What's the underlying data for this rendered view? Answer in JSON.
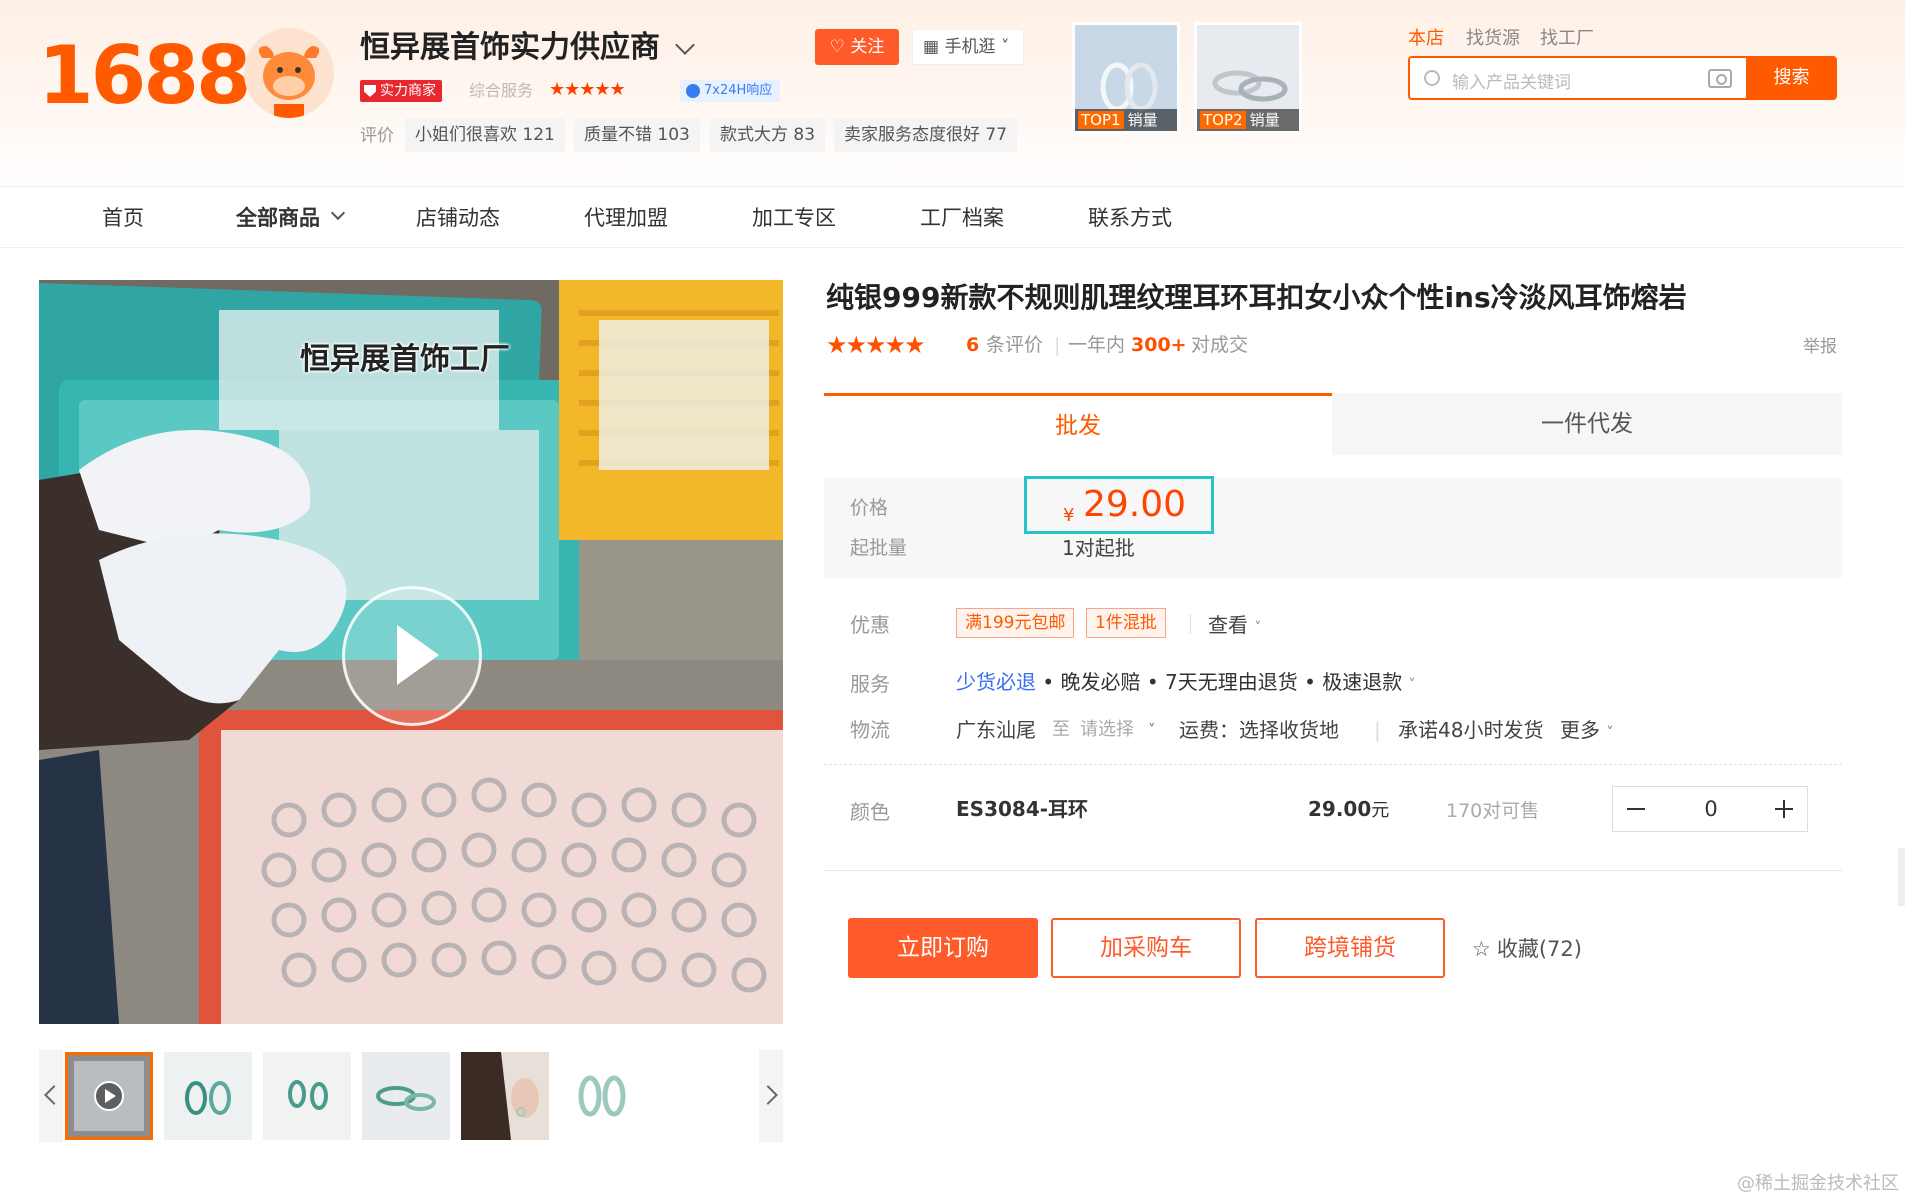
{
  "header": {
    "logo": "1688",
    "shop_name": "恒异展首饰实力供应商",
    "badge_strength": "实力商家",
    "service_label": "综合服务",
    "service_stars": "★★★★★",
    "response_badge": "7x24H响应",
    "eval_label": "评价",
    "review_tags": [
      {
        "text": "小姐们很喜欢",
        "count": "121"
      },
      {
        "text": "质量不错",
        "count": "103"
      },
      {
        "text": "款式大方",
        "count": "83"
      },
      {
        "text": "卖家服务态度很好",
        "count": "77"
      }
    ],
    "follow_button": "关注",
    "mobile_button": "手机逛",
    "top_products": [
      {
        "rank": "TOP1",
        "label": "销量"
      },
      {
        "rank": "TOP2",
        "label": "销量"
      }
    ],
    "search_tabs": [
      "本店",
      "找货源",
      "找工厂"
    ],
    "search_placeholder": "输入产品关键词",
    "search_button": "搜索"
  },
  "nav": {
    "items": [
      "首页",
      "全部商品",
      "店铺动态",
      "代理加盟",
      "加工专区",
      "工厂档案",
      "联系方式"
    ]
  },
  "media": {
    "video_overlay_text": "恒异展首饰工厂",
    "thumb_count": 6
  },
  "product": {
    "title": "纯银999新款不规则肌理纹理耳环耳扣女小众个性ins冷淡风耳饰熔岩",
    "stars": "★★★★★",
    "review_count": "6",
    "review_label": "条评价",
    "year_label": "一年内",
    "deals": "300+",
    "deals_label": "对成交",
    "report": "举报",
    "tabs": [
      "批发",
      "一件代发"
    ],
    "price_label": "价格",
    "currency": "¥",
    "price": "29.00",
    "min_label": "起批量",
    "min_value": "1对起批",
    "discount_label": "优惠",
    "coupons": [
      "满199元包邮",
      "1件混批"
    ],
    "see_label": "查看",
    "service_label": "服务",
    "services": [
      "少货必退",
      "晚发必赔",
      "7天无理由退货",
      "极速退款"
    ],
    "logistics_label": "物流",
    "ship_from": "广东汕尾",
    "to_label": "至",
    "ship_to": "请选择",
    "freight": "运费：选择收货地",
    "promise": "承诺48小时发货",
    "more": "更多",
    "color_label": "颜色",
    "sku_code": "ES3084-耳环",
    "sku_price": "29.00",
    "sku_unit": "元",
    "stock": "170对可售",
    "quantity": "0",
    "buttons": {
      "order": "立即订购",
      "cart": "加采购车",
      "cross": "跨境铺货",
      "favorite": "收藏(72)"
    }
  },
  "watermark": "@稀土掘金技术社区",
  "colors": {
    "brand_orange": "#ff5a00",
    "price_red": "#ff4400",
    "highlight_cyan": "#28c2c9",
    "link_blue": "#3a6ff0"
  }
}
